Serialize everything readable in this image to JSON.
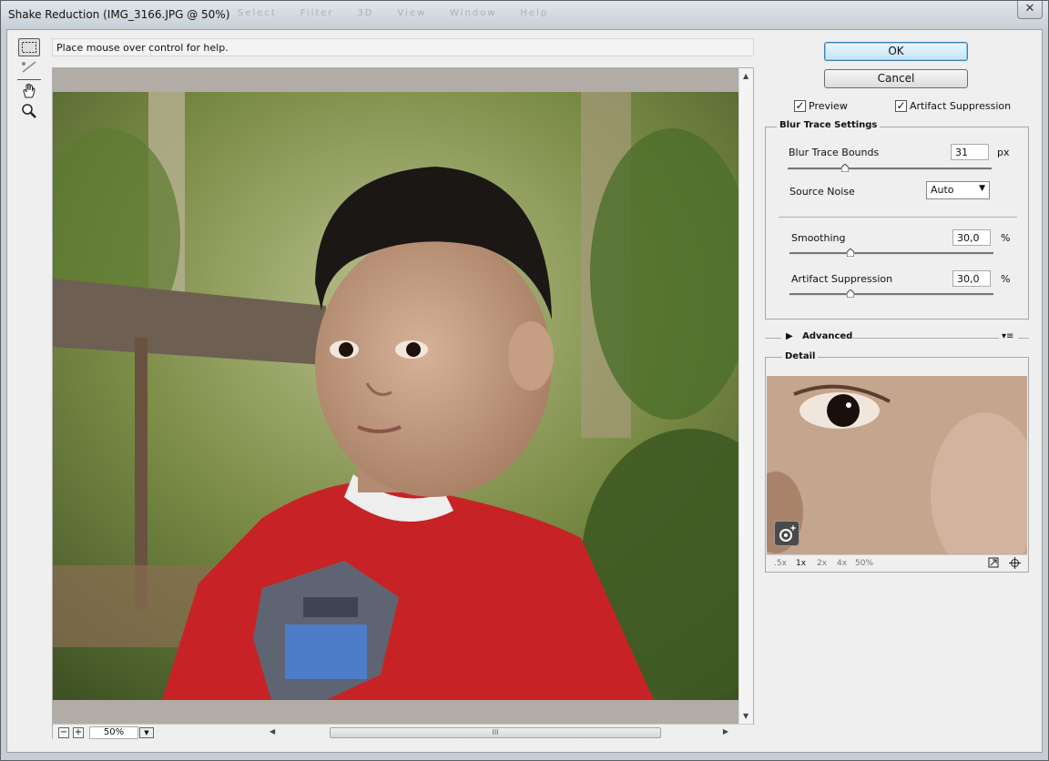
{
  "window": {
    "title": "Shake Reduction (IMG_3166.JPG @ 50%)",
    "close_glyph": "✕",
    "ghost_menu": [
      "Select",
      "Filter",
      "3D",
      "View",
      "Window",
      "Help"
    ]
  },
  "toolbar": {
    "tools": [
      {
        "name": "blur-estimation-tool-icon",
        "active": true
      },
      {
        "name": "blur-direction-tool-icon",
        "active": false
      },
      {
        "name": "hand-tool-icon",
        "active": false
      },
      {
        "name": "zoom-tool-icon",
        "active": false
      }
    ]
  },
  "help": {
    "text": "Place mouse over control for help."
  },
  "canvas": {
    "zoom_value": "50%",
    "zoom_out": "−",
    "zoom_in": "+",
    "scroll_grip": "III"
  },
  "actions": {
    "ok": "OK",
    "cancel": "Cancel"
  },
  "options": {
    "preview": {
      "label": "Preview",
      "checked": true
    },
    "artifact_suppression": {
      "label": "Artifact Suppression",
      "checked": true
    }
  },
  "blur_trace": {
    "title": "Blur Trace Settings",
    "bounds": {
      "label": "Blur Trace Bounds",
      "value": "31",
      "unit": "px",
      "level": 0.28
    },
    "source_noise": {
      "label": "Source Noise",
      "value": "Auto"
    },
    "smoothing": {
      "label": "Smoothing",
      "value": "30,0",
      "unit": "%",
      "level": 0.3
    },
    "artifact": {
      "label": "Artifact Suppression",
      "value": "30,0",
      "unit": "%",
      "level": 0.3
    }
  },
  "advanced": {
    "label": "Advanced"
  },
  "detail": {
    "title": "Detail",
    "zoom_levels": [
      ".5x",
      "1x",
      "2x",
      "4x",
      "50%"
    ],
    "active_zoom": "1x"
  },
  "colors": {
    "ok_border": "#3c7fb1",
    "panel_bg": "#efefef"
  }
}
